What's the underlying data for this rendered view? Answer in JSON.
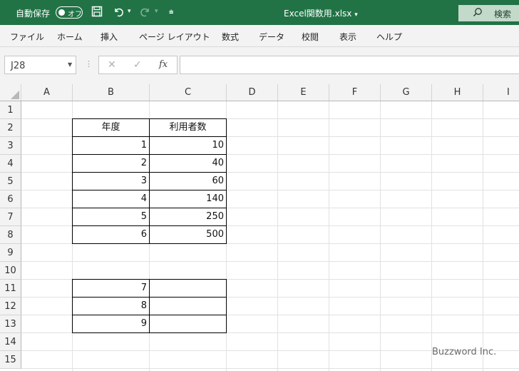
{
  "titlebar": {
    "autosave_label": "自動保存",
    "autosave_state": "オフ",
    "filename": "Excel関数用.xlsx",
    "filename_caret": "▾",
    "search_label": "検索"
  },
  "menu": [
    "ファイル",
    "ホーム",
    "挿入",
    "ページ レイアウト",
    "数式",
    "データ",
    "校閲",
    "表示",
    "ヘルプ"
  ],
  "formula_bar": {
    "name_box": "J28",
    "fx": "fx",
    "formula": ""
  },
  "columns": [
    "A",
    "B",
    "C",
    "D",
    "E",
    "F",
    "G",
    "H",
    "I"
  ],
  "rows": [
    "1",
    "2",
    "3",
    "4",
    "5",
    "6",
    "7",
    "8",
    "9",
    "10",
    "11",
    "12",
    "13",
    "14",
    "15"
  ],
  "table1": {
    "header_b": "年度",
    "header_c": "利用者数",
    "b": [
      "1",
      "2",
      "3",
      "4",
      "5",
      "6"
    ],
    "c": [
      "10",
      "40",
      "60",
      "140",
      "250",
      "500"
    ]
  },
  "table2": {
    "b": [
      "7",
      "8",
      "9"
    ]
  },
  "watermark": "Buzzword Inc."
}
